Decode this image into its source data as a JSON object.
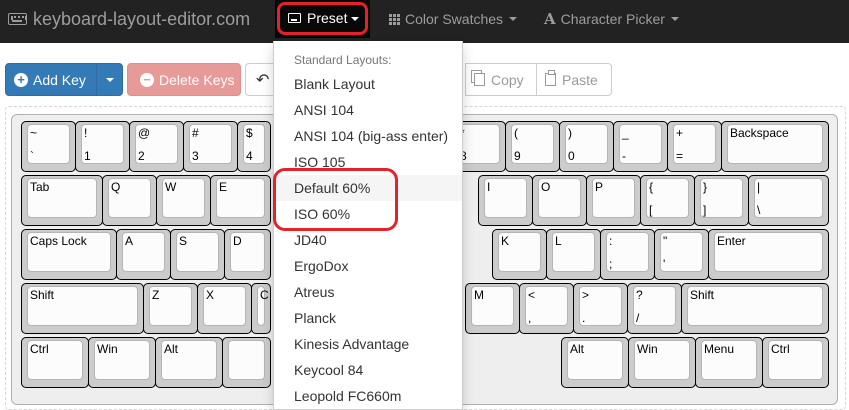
{
  "navbar": {
    "brand": "keyboard-layout-editor.com",
    "brand_icon": "keyboard-icon",
    "preset": "Preset",
    "color_swatches": "Color Swatches",
    "character_picker": "Character Picker",
    "character_picker_icon": "A"
  },
  "toolbar": {
    "add_key": "Add Key",
    "delete_keys": "Delete Keys",
    "copy": "Copy",
    "paste": "Paste"
  },
  "dropdown": {
    "header": "Standard Layouts:",
    "items": [
      "Blank Layout",
      "ANSI 104",
      "ANSI 104 (big-ass enter)",
      "ISO 105",
      "Default 60%",
      "ISO 60%",
      "JD40",
      "ErgoDox",
      "Atreus",
      "Planck",
      "Kinesis Advantage",
      "Keycool 84",
      "Leopold FC660m"
    ],
    "hovered_item": "Default 60%"
  },
  "keyboard": {
    "keys": [
      {
        "t": "~",
        "b": "`"
      },
      {
        "t": "!",
        "b": "1"
      },
      {
        "t": "@",
        "b": "2"
      },
      {
        "t": "#",
        "b": "3"
      },
      {
        "t": "$",
        "b": "4"
      },
      {
        "t": "*",
        "b": "8"
      },
      {
        "t": "(",
        "b": "9"
      },
      {
        "t": ")",
        "b": "0"
      },
      {
        "t": "_",
        "b": "-"
      },
      {
        "t": "+",
        "b": "="
      },
      {
        "t": "Backspace",
        "b": ""
      },
      {
        "t": "Tab",
        "b": ""
      },
      {
        "t": "Q",
        "b": ""
      },
      {
        "t": "W",
        "b": ""
      },
      {
        "t": "E",
        "b": ""
      },
      {
        "t": "I",
        "b": ""
      },
      {
        "t": "O",
        "b": ""
      },
      {
        "t": "P",
        "b": ""
      },
      {
        "t": "{",
        "b": "["
      },
      {
        "t": "}",
        "b": "]"
      },
      {
        "t": "|",
        "b": "\\"
      },
      {
        "t": "Caps Lock",
        "b": ""
      },
      {
        "t": "A",
        "b": ""
      },
      {
        "t": "S",
        "b": ""
      },
      {
        "t": "D",
        "b": ""
      },
      {
        "t": "K",
        "b": ""
      },
      {
        "t": "L",
        "b": ""
      },
      {
        "t": ":",
        "b": ";"
      },
      {
        "t": "\"",
        "b": "'"
      },
      {
        "t": "Enter",
        "b": ""
      },
      {
        "t": "Shift",
        "b": ""
      },
      {
        "t": "Z",
        "b": ""
      },
      {
        "t": "X",
        "b": ""
      },
      {
        "t": "C",
        "b": ""
      },
      {
        "t": "M",
        "b": ""
      },
      {
        "t": "<",
        "b": ","
      },
      {
        "t": ">",
        "b": "."
      },
      {
        "t": "?",
        "b": "/"
      },
      {
        "t": "Shift",
        "b": ""
      },
      {
        "t": "Ctrl",
        "b": ""
      },
      {
        "t": "Win",
        "b": ""
      },
      {
        "t": "Alt",
        "b": ""
      },
      {
        "t": "",
        "b": ""
      },
      {
        "t": "Alt",
        "b": ""
      },
      {
        "t": "Win",
        "b": ""
      },
      {
        "t": "Menu",
        "b": ""
      },
      {
        "t": "Ctrl",
        "b": ""
      }
    ]
  },
  "colors": {
    "navbar_bg": "#222222",
    "primary": "#337ab7",
    "danger_disabled": "#e69b98",
    "highlight_ring": "#e3222b",
    "keycap": "#fcfcfc",
    "keyboard_bg": "#eeeeee"
  }
}
